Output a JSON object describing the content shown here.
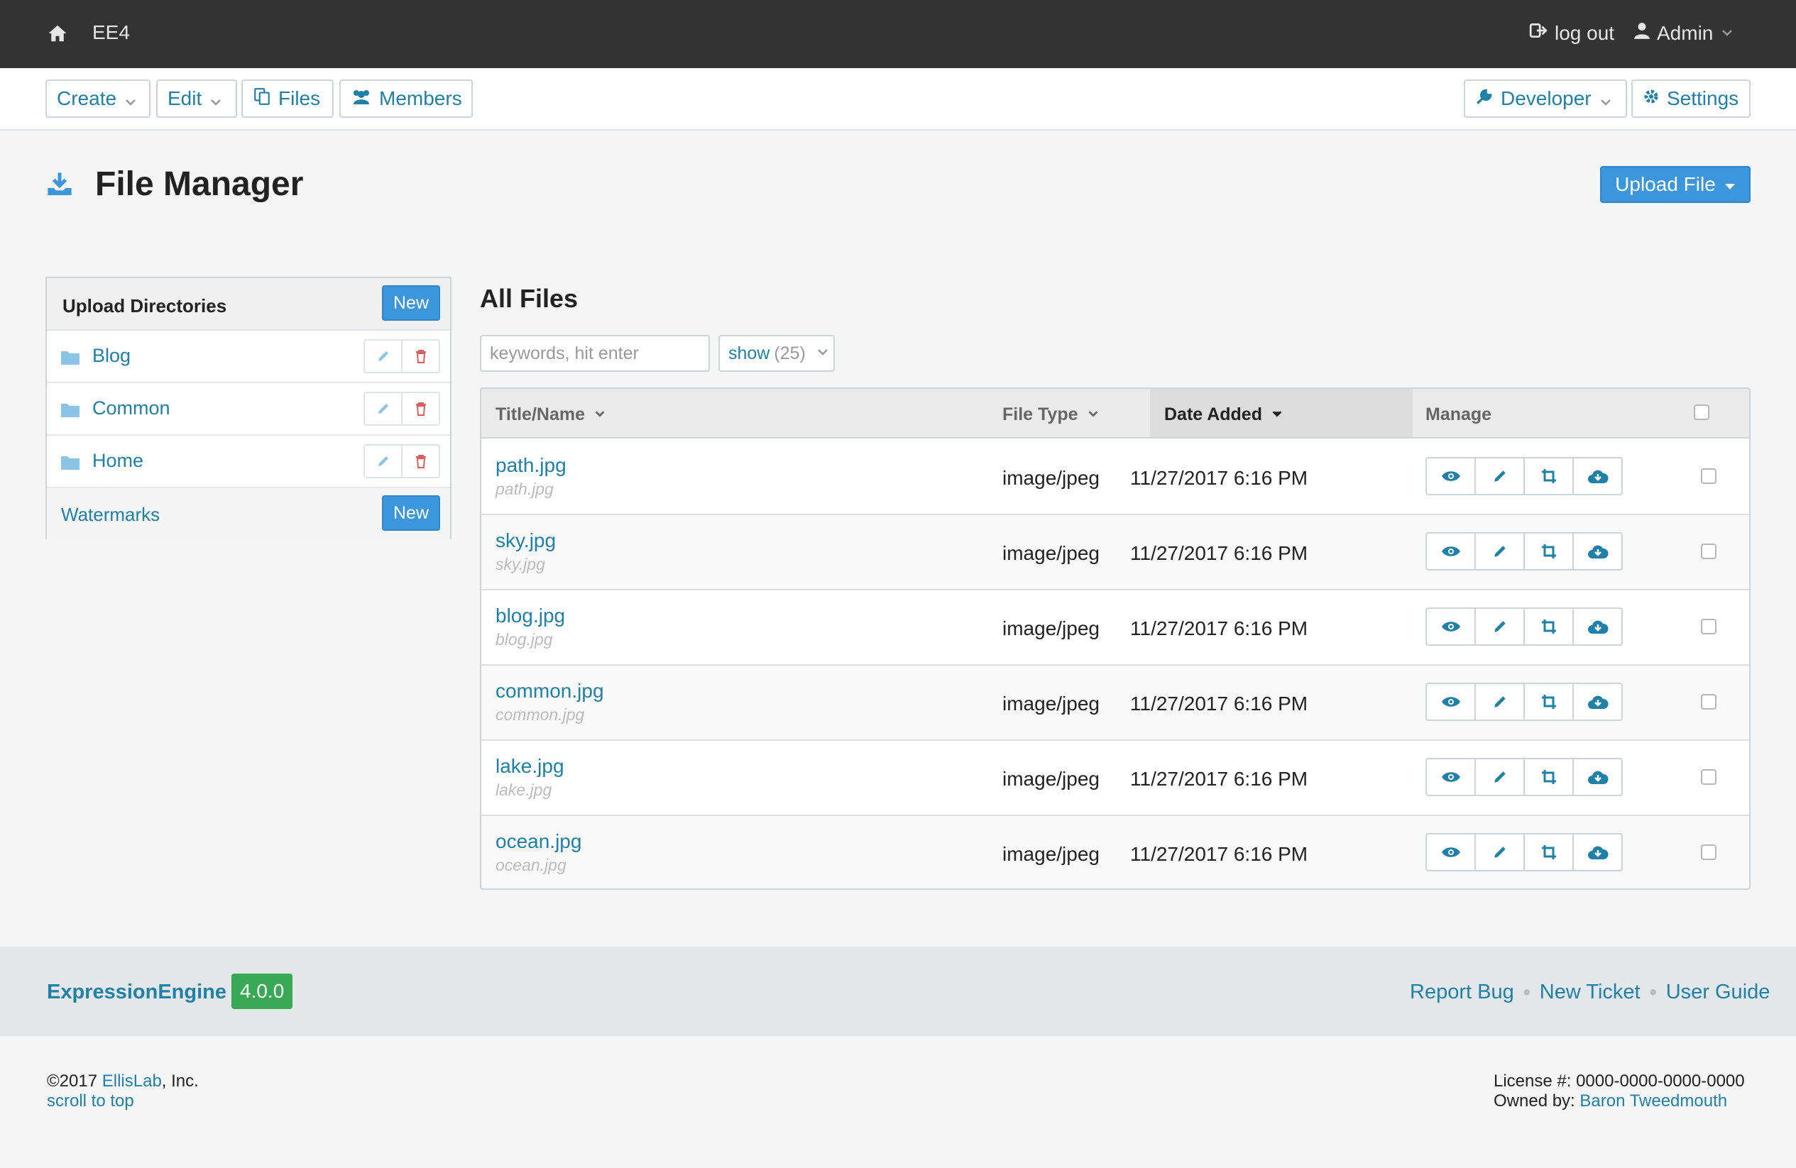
{
  "topbar": {
    "site_name": "EE4",
    "logout_label": "log out",
    "user_label": "Admin"
  },
  "nav": {
    "create": "Create",
    "edit": "Edit",
    "files": "Files",
    "members": "Members",
    "developer": "Developer",
    "settings": "Settings"
  },
  "page": {
    "title": "File Manager",
    "upload_button": "Upload File"
  },
  "sidebar": {
    "heading": "Upload Directories",
    "new_label": "New",
    "items": [
      {
        "label": "Blog"
      },
      {
        "label": "Common"
      },
      {
        "label": "Home"
      }
    ],
    "watermarks_label": "Watermarks",
    "watermarks_new": "New"
  },
  "main": {
    "heading": "All Files",
    "search_placeholder": "keywords, hit enter",
    "show_label": "show",
    "show_count": "(25)",
    "columns": {
      "title": "Title/Name",
      "type": "File Type",
      "date": "Date Added",
      "manage": "Manage"
    },
    "rows": [
      {
        "title": "path.jpg",
        "filename": "path.jpg",
        "type": "image/jpeg",
        "date": "11/27/2017 6:16 PM"
      },
      {
        "title": "sky.jpg",
        "filename": "sky.jpg",
        "type": "image/jpeg",
        "date": "11/27/2017 6:16 PM"
      },
      {
        "title": "blog.jpg",
        "filename": "blog.jpg",
        "type": "image/jpeg",
        "date": "11/27/2017 6:16 PM"
      },
      {
        "title": "common.jpg",
        "filename": "common.jpg",
        "type": "image/jpeg",
        "date": "11/27/2017 6:16 PM"
      },
      {
        "title": "lake.jpg",
        "filename": "lake.jpg",
        "type": "image/jpeg",
        "date": "11/27/2017 6:16 PM"
      },
      {
        "title": "ocean.jpg",
        "filename": "ocean.jpg",
        "type": "image/jpeg",
        "date": "11/27/2017 6:16 PM"
      }
    ]
  },
  "footer": {
    "product": "ExpressionEngine",
    "version": "4.0.0",
    "links": [
      "Report Bug",
      "New Ticket",
      "User Guide"
    ],
    "copyright_prefix": "©2017 ",
    "company": "EllisLab",
    "copyright_suffix": ", Inc.",
    "scroll_top": "scroll to top",
    "license": "License #: 0000-0000-0000-0000",
    "owned_prefix": "Owned by: ",
    "owner": "Baron Tweedmouth"
  },
  "colors": {
    "topbar": "#333333",
    "link": "#1f80a8",
    "primary_button": "#3b96dc",
    "version_badge": "#3aa956",
    "delete_icon": "#e05d5d"
  },
  "icons": {
    "home": "home-icon",
    "logout": "logout-icon",
    "user": "user-icon",
    "files": "files-icon",
    "members": "members-icon",
    "developer": "wrench-icon",
    "settings": "gear-icon",
    "page": "download-icon",
    "folder": "folder-icon",
    "edit": "pencil-icon",
    "delete": "trash-icon",
    "view": "eye-icon",
    "crop": "crop-icon",
    "download": "cloud-download-icon"
  }
}
